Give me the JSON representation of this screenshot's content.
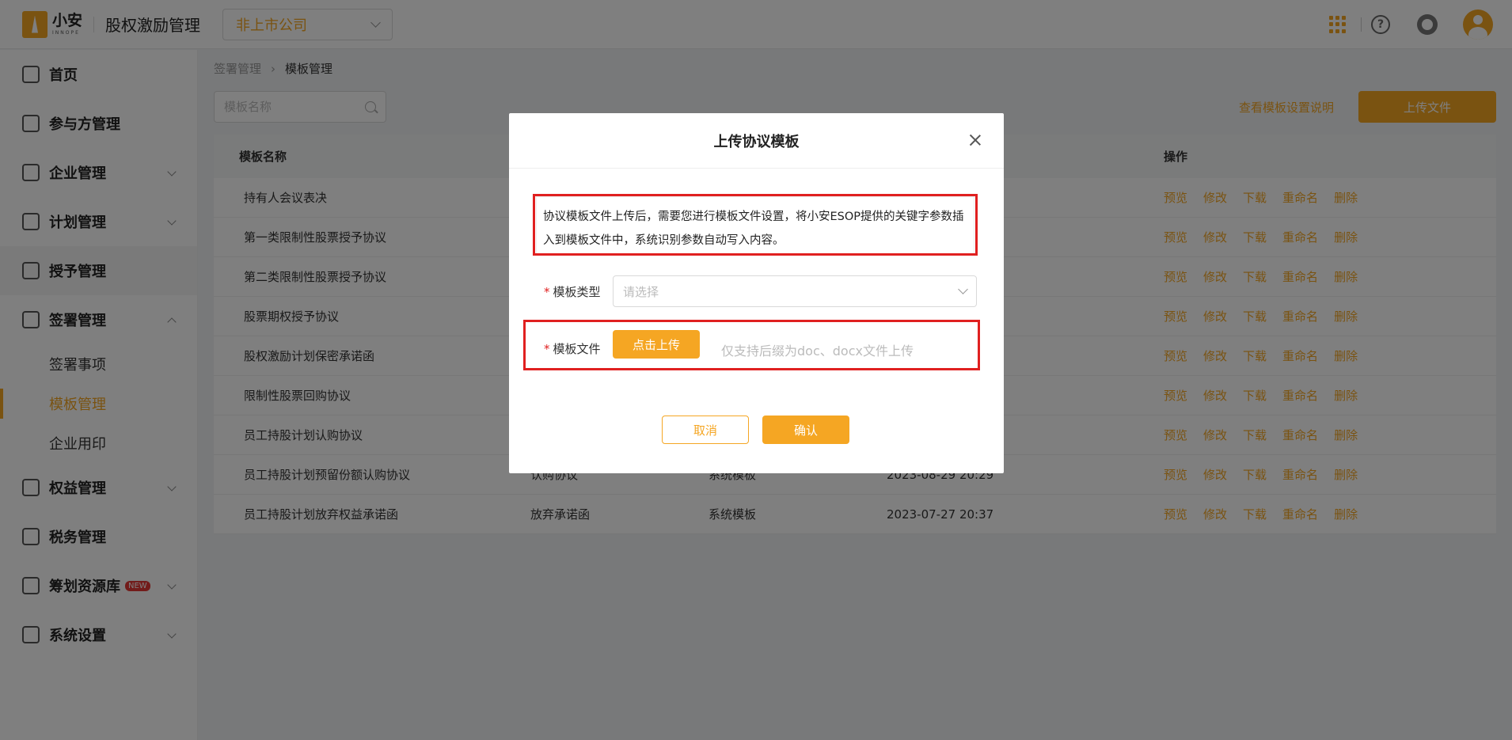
{
  "header": {
    "logo_cn": "小安",
    "logo_en": "INNOPE",
    "app_title": "股权激励管理",
    "company_select": "非上市公司",
    "help_glyph": "?"
  },
  "sidebar": {
    "items": [
      {
        "label": "首页",
        "icon": "home-icon"
      },
      {
        "label": "参与方管理",
        "icon": "users-icon"
      },
      {
        "label": "企业管理",
        "icon": "company-icon"
      },
      {
        "label": "计划管理",
        "icon": "plan-icon"
      },
      {
        "label": "授予管理",
        "icon": "grant-icon"
      },
      {
        "label": "签署管理",
        "icon": "sign-icon"
      },
      {
        "label": "权益管理",
        "icon": "equity-icon"
      },
      {
        "label": "税务管理",
        "icon": "tax-icon"
      },
      {
        "label": "筹划资源库",
        "icon": "layers-icon",
        "badge": "NEW"
      },
      {
        "label": "系统设置",
        "icon": "settings-icon"
      }
    ],
    "sub_items": [
      {
        "label": "签署事项"
      },
      {
        "label": "模板管理"
      },
      {
        "label": "企业用印"
      }
    ]
  },
  "breadcrumb": [
    "签署管理",
    "模板管理"
  ],
  "search": {
    "placeholder": "模板名称"
  },
  "toolbar": {
    "help_link": "查看模板设置说明",
    "upload_button": "上传文件"
  },
  "table": {
    "headers": [
      "模板名称",
      "",
      "",
      "",
      "操作"
    ],
    "actions": [
      "预览",
      "修改",
      "下载",
      "重命名",
      "删除"
    ],
    "rows": [
      {
        "name": "持有人会议表决",
        "type": "",
        "source": "",
        "time": ""
      },
      {
        "name": "第一类限制性股票授予协议",
        "type": "",
        "source": "",
        "time": ""
      },
      {
        "name": "第二类限制性股票授予协议",
        "type": "",
        "source": "",
        "time": ""
      },
      {
        "name": "股票期权授予协议",
        "type": "",
        "source": "",
        "time": ""
      },
      {
        "name": "股权激励计划保密承诺函",
        "type": "",
        "source": "",
        "time": ""
      },
      {
        "name": "限制性股票回购协议",
        "type": "",
        "source": "",
        "time": ""
      },
      {
        "name": "员工持股计划认购协议",
        "type": "",
        "source": "",
        "time": ""
      },
      {
        "name": "员工持股计划预留份额认购协议",
        "type": "认购协议",
        "source": "系统模板",
        "time": "2023-08-29 20:29"
      },
      {
        "name": "员工持股计划放弃权益承诺函",
        "type": "放弃承诺函",
        "source": "系统模板",
        "time": "2023-07-27 20:37"
      }
    ]
  },
  "modal": {
    "title": "上传协议模板",
    "notice": "协议模板文件上传后，需要您进行模板文件设置，将小安ESOP提供的关键字参数插入到模板文件中，系统识别参数自动写入内容。",
    "type_label": "模板类型",
    "type_placeholder": "请选择",
    "file_label": "模板文件",
    "upload_button": "点击上传",
    "file_hint": "仅支持后缀为doc、docx文件上传",
    "required_mark": "*",
    "cancel": "取消",
    "confirm": "确认"
  },
  "colors": {
    "accent": "#f5a623",
    "highlight": "#e02020",
    "overlay": "rgba(0,0,0,0.5)"
  }
}
